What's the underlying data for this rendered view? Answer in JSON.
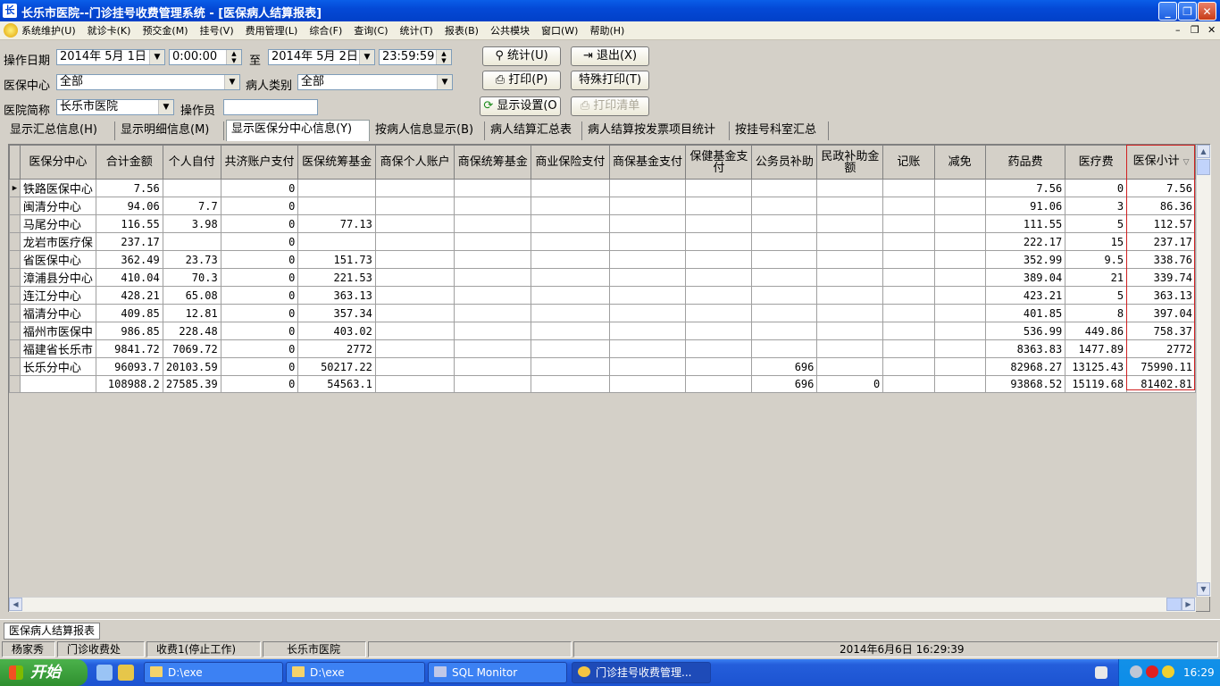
{
  "window": {
    "title": "长乐市医院--门诊挂号收费管理系统 - [医保病人结算报表]",
    "app_icon_glyph": "长",
    "minimize_glyph": "_",
    "restore_glyph": "❐",
    "close_glyph": "✕"
  },
  "menu": {
    "items": [
      "系统维护(U)",
      "就诊卡(K)",
      "预交金(M)",
      "挂号(V)",
      "费用管理(L)",
      "综合(F)",
      "查询(C)",
      "统计(T)",
      "报表(B)",
      "公共模块",
      "窗口(W)",
      "帮助(H)"
    ],
    "mdi_min": "–",
    "mdi_restore": "❐",
    "mdi_close": "✕"
  },
  "filters": {
    "op_date_label": "操作日期",
    "start_date": "2014年 5月 1日",
    "start_time": "0:00:00",
    "to_label": "至",
    "end_date": "2014年 5月 2日",
    "end_time": "23:59:59",
    "center_label": "医保中心",
    "center_value": "全部",
    "patient_type_label": "病人类别",
    "patient_type_value": "全部",
    "hospital_label": "医院简称",
    "hospital_value": "长乐市医院",
    "operator_label": "操作员",
    "operator_value": ""
  },
  "buttons": {
    "stats": "统计(U)",
    "exit": "退出(X)",
    "print": "打印(P)",
    "special_print": "特殊打印(T)",
    "display_settings": "显示设置(O",
    "print_list": "打印清单"
  },
  "tabs": [
    "显示汇总信息(H)",
    "显示明细信息(M)",
    "显示医保分中心信息(Y)",
    "按病人信息显示(B)",
    "病人结算汇总表",
    "病人结算按发票项目统计",
    "按挂号科室汇总"
  ],
  "active_tab": 2,
  "table": {
    "columns": [
      "医保分中心",
      "合计金额",
      "个人自付",
      "共济账户支付",
      "医保统筹基金",
      "商保个人账户",
      "商保统筹基金",
      "商业保险支付",
      "商保基金支付",
      "保健基金支付",
      "公务员补助",
      "民政补助金额",
      "记账",
      "减免",
      "药品费",
      "医疗费",
      "医保小计"
    ],
    "rows": [
      [
        "铁路医保中心",
        "7.56",
        "",
        "0",
        "",
        "",
        "",
        "",
        "",
        "",
        "",
        "",
        "",
        "",
        "7.56",
        "0",
        "7.56"
      ],
      [
        "闽清分中心",
        "94.06",
        "7.7",
        "0",
        "",
        "",
        "",
        "",
        "",
        "",
        "",
        "",
        "",
        "",
        "91.06",
        "3",
        "86.36"
      ],
      [
        "马尾分中心",
        "116.55",
        "3.98",
        "0",
        "77.13",
        "",
        "",
        "",
        "",
        "",
        "",
        "",
        "",
        "",
        "111.55",
        "5",
        "112.57"
      ],
      [
        "龙岩市医疗保",
        "237.17",
        "",
        "0",
        "",
        "",
        "",
        "",
        "",
        "",
        "",
        "",
        "",
        "",
        "222.17",
        "15",
        "237.17"
      ],
      [
        "省医保中心",
        "362.49",
        "23.73",
        "0",
        "151.73",
        "",
        "",
        "",
        "",
        "",
        "",
        "",
        "",
        "",
        "352.99",
        "9.5",
        "338.76"
      ],
      [
        "漳浦县分中心",
        "410.04",
        "70.3",
        "0",
        "221.53",
        "",
        "",
        "",
        "",
        "",
        "",
        "",
        "",
        "",
        "389.04",
        "21",
        "339.74"
      ],
      [
        "连江分中心",
        "428.21",
        "65.08",
        "0",
        "363.13",
        "",
        "",
        "",
        "",
        "",
        "",
        "",
        "",
        "",
        "423.21",
        "5",
        "363.13"
      ],
      [
        "福清分中心",
        "409.85",
        "12.81",
        "0",
        "357.34",
        "",
        "",
        "",
        "",
        "",
        "",
        "",
        "",
        "",
        "401.85",
        "8",
        "397.04"
      ],
      [
        "福州市医保中",
        "986.85",
        "228.48",
        "0",
        "403.02",
        "",
        "",
        "",
        "",
        "",
        "",
        "",
        "",
        "",
        "536.99",
        "449.86",
        "758.37"
      ],
      [
        "福建省长乐市",
        "9841.72",
        "7069.72",
        "0",
        "2772",
        "",
        "",
        "",
        "",
        "",
        "",
        "",
        "",
        "",
        "8363.83",
        "1477.89",
        "2772"
      ],
      [
        "长乐分中心",
        "96093.7",
        "20103.59",
        "0",
        "50217.22",
        "",
        "",
        "",
        "",
        "",
        "696",
        "",
        "",
        "",
        "82968.27",
        "13125.43",
        "75990.11"
      ],
      [
        "",
        "108988.2",
        "27585.39",
        "0",
        "54563.1",
        "",
        "",
        "",
        "",
        "",
        "696",
        "0",
        "",
        "",
        "93868.52",
        "15119.68",
        "81402.81"
      ]
    ],
    "current_row_indicator": "▶",
    "sort_glyph": "▽"
  },
  "window_list": [
    "医保病人结算报表"
  ],
  "status": {
    "user": "杨家秀",
    "dept": "门诊收费处",
    "terminal": "收费1(停止工作)",
    "hospital": "长乐市医院",
    "datetime": "2014年6月6日 16:29:39"
  },
  "taskbar": {
    "start_label": "开始",
    "tasks": [
      "D:\\exe",
      "D:\\exe",
      "SQL Monitor",
      "门诊挂号收费管理..."
    ],
    "clock": "16:29"
  }
}
